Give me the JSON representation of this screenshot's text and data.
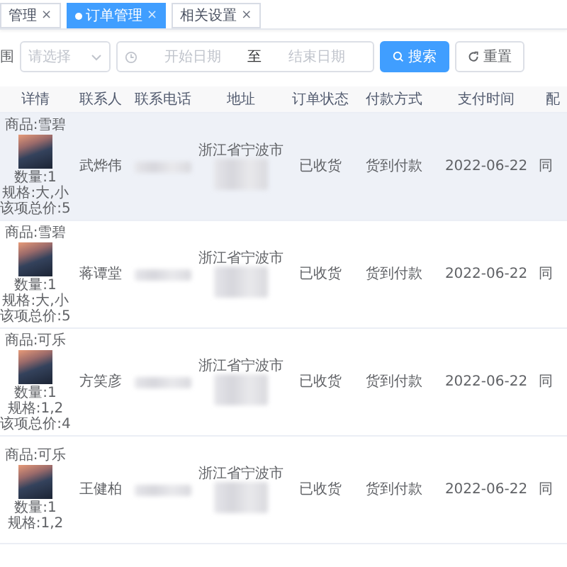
{
  "tabs": [
    {
      "label": "管理",
      "selected": false,
      "close": "×"
    },
    {
      "label": "订单管理",
      "selected": true,
      "close": "×"
    },
    {
      "label": "相关设置",
      "selected": false,
      "close": "×"
    }
  ],
  "filter": {
    "label": "围",
    "select_placeholder": "请选择",
    "start_placeholder": "开始日期",
    "separator": "至",
    "end_placeholder": "结束日期"
  },
  "buttons": [
    {
      "label": "搜索",
      "kind": "primary"
    },
    {
      "label": "重置",
      "kind": "default"
    }
  ],
  "table": {
    "columns": [
      "详情",
      "联系人",
      "联系电话",
      "地址",
      "订单状态",
      "付款方式",
      "支付时间",
      "配"
    ],
    "rows": [
      {
        "highlighted": true,
        "product": "商品:雪碧",
        "lines": [
          "数量:1",
          "规格:大,小",
          "该项总价:5"
        ],
        "contact": "武烨伟",
        "city": "浙江省宁波市",
        "status": "已收货",
        "payment": "货到付款",
        "date": "2022-06-22",
        "column_8": "同"
      },
      {
        "highlighted": false,
        "product": "商品:雪碧",
        "lines": [
          "数量:1",
          "规格:大,小",
          "该项总价:5"
        ],
        "contact": "蒋谭堂",
        "city": "浙江省宁波市",
        "status": "已收货",
        "payment": "货到付款",
        "date": "2022-06-22",
        "column_8": "同"
      },
      {
        "highlighted": false,
        "product": "商品:可乐",
        "lines": [
          "数量:1",
          "规格:1,2",
          "该项总价:4"
        ],
        "contact": "方笑彦",
        "city": "浙江省宁波市",
        "status": "已收货",
        "payment": "货到付款",
        "date": "2022-06-22",
        "column_8": "同"
      },
      {
        "highlighted": false,
        "product": "商品:可乐",
        "lines": [
          "数量:1",
          "规格:1,2"
        ],
        "contact": "王健柏",
        "city": "浙江省宁波市",
        "status": "已收货",
        "payment": "货到付款",
        "date": "2022-06-22",
        "column_8": "同"
      }
    ]
  }
}
